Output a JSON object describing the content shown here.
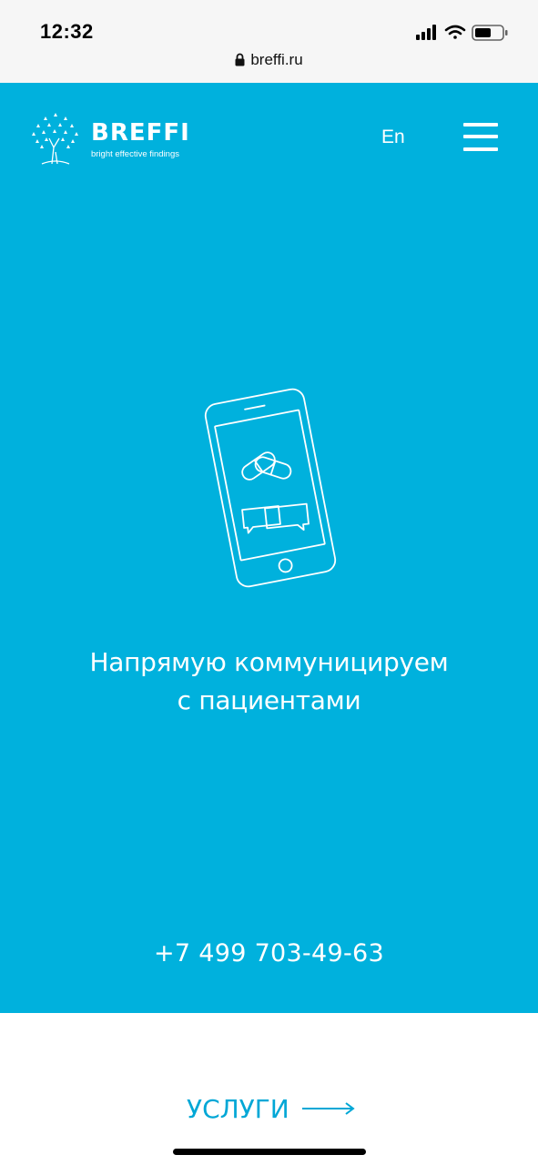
{
  "status_bar": {
    "time": "12:32"
  },
  "browser": {
    "url": "breffi.ru"
  },
  "header": {
    "brand": "BREFFI",
    "tagline": "bright effective findings",
    "lang_switch": "En"
  },
  "hero": {
    "headline_line1": "Напрямую коммуницируем",
    "headline_line2": "с пациентами",
    "phone": "+7 499 703-49-63"
  },
  "services": {
    "label": "УСЛУГИ"
  },
  "colors": {
    "hero_bg": "#00b1dd",
    "accent": "#00a7d6"
  }
}
